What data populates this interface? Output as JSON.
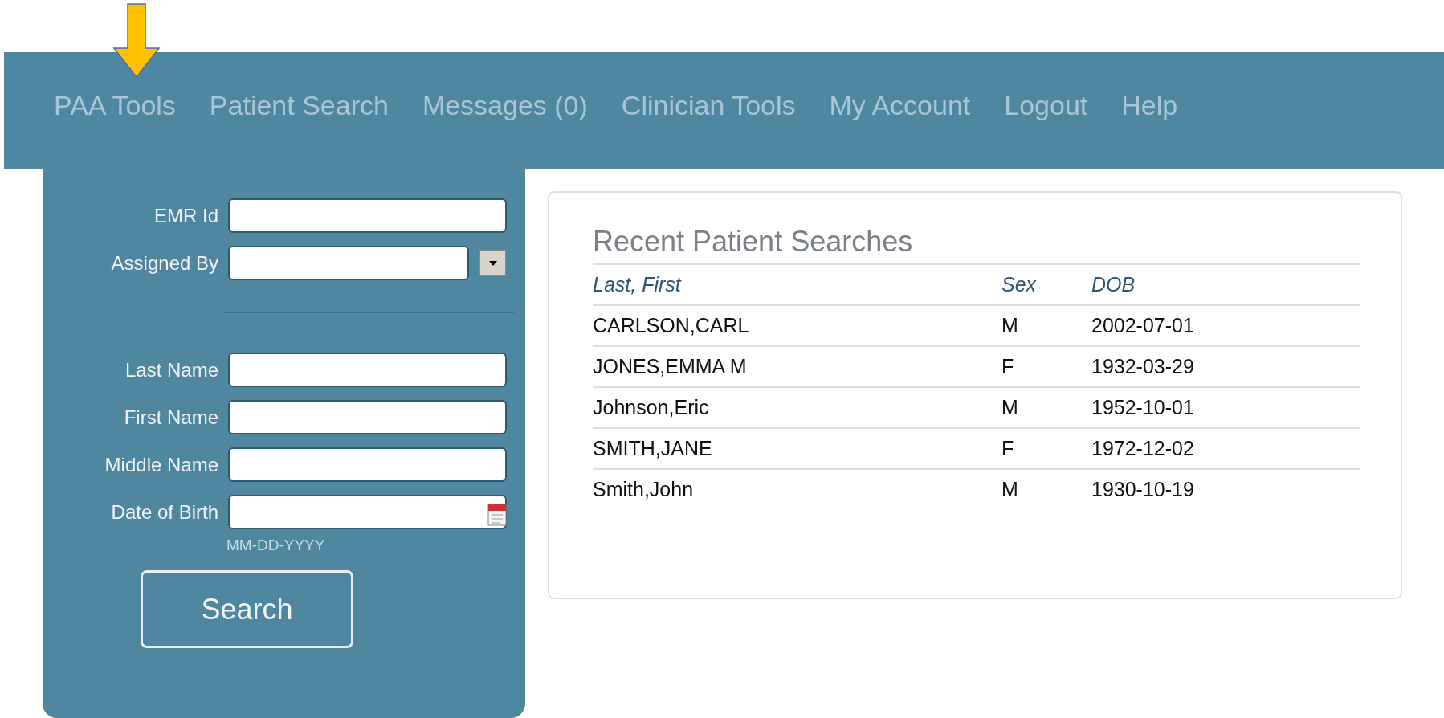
{
  "nav": {
    "items": [
      "PAA Tools",
      "Patient Search",
      "Messages (0)",
      "Clinician Tools",
      "My Account",
      "Logout",
      "Help"
    ]
  },
  "search_form": {
    "fields": [
      {
        "label": "EMR Id",
        "kind": "text"
      },
      {
        "label": "Assigned By",
        "kind": "dropdown"
      },
      {
        "kind": "divider"
      },
      {
        "label": "Last Name",
        "kind": "text"
      },
      {
        "label": "First Name",
        "kind": "text"
      },
      {
        "label": "Middle Name",
        "kind": "text"
      },
      {
        "label": "Date of Birth",
        "kind": "date",
        "hint": "MM-DD-YYYY"
      }
    ],
    "button": "Search"
  },
  "recent_searches": {
    "title": "Recent Patient Searches",
    "columns": [
      "Last, First",
      "Sex",
      "DOB"
    ],
    "rows": [
      [
        "CARLSON,CARL",
        "M",
        "2002-07-01"
      ],
      [
        "JONES,EMMA M",
        "F",
        "1932-03-29"
      ],
      [
        "Johnson,Eric",
        "M",
        "1952-10-01"
      ],
      [
        "SMITH,JANE",
        "F",
        "1972-12-02"
      ],
      [
        "Smith,John",
        "M",
        "1930-10-19"
      ]
    ]
  }
}
